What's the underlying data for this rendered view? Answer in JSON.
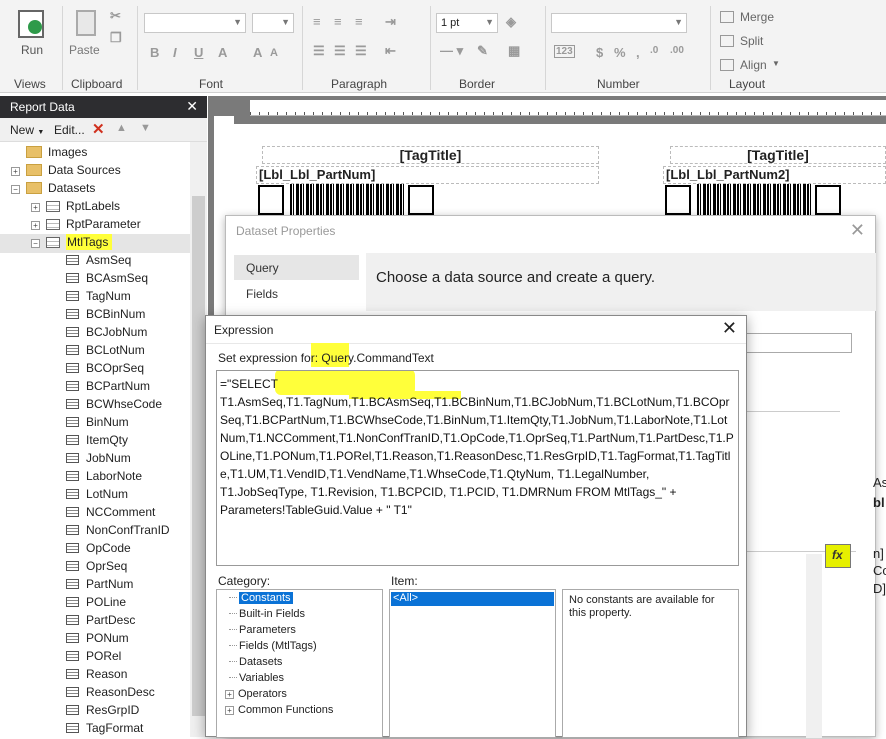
{
  "ribbon": {
    "run_label": "Run",
    "paste_label": "Paste",
    "font_size_value": "1 pt",
    "merge_label": "Merge",
    "split_label": "Split",
    "align_label": "Align",
    "groups": {
      "views": "Views",
      "clipboard": "Clipboard",
      "font": "Font",
      "paragraph": "Paragraph",
      "border": "Border",
      "number": "Number",
      "layout": "Layout"
    },
    "number_symbols": {
      "currency": "$",
      "percent": "%",
      "comma": ","
    }
  },
  "report_data": {
    "title": "Report Data",
    "toolbar": {
      "new_label": "New",
      "edit_label": "Edit..."
    },
    "tree": {
      "images": "Images",
      "data_sources": "Data Sources",
      "datasets": "Datasets",
      "rptlabels": "RptLabels",
      "rptparameter": "RptParameter",
      "mtltags": "MtlTags",
      "fields": [
        "AsmSeq",
        "BCAsmSeq",
        "TagNum",
        "BCBinNum",
        "BCJobNum",
        "BCLotNum",
        "BCOprSeq",
        "BCPartNum",
        "BCWhseCode",
        "BinNum",
        "ItemQty",
        "JobNum",
        "LaborNote",
        "LotNum",
        "NCComment",
        "NonConfTranID",
        "OpCode",
        "OprSeq",
        "PartNum",
        "POLine",
        "PartDesc",
        "PONum",
        "PORel",
        "Reason",
        "ReasonDesc",
        "ResGrpID",
        "TagFormat"
      ]
    }
  },
  "design": {
    "tag_title_1": "[TagTitle]",
    "tag_title_2": "[TagTitle]",
    "lbl_1": "[Lbl_Lbl_PartNum]",
    "lbl_2": "[Lbl_Lbl_PartNum2]",
    "partial_right": [
      "As",
      "bl",
      "n]",
      "Co",
      "D]"
    ]
  },
  "dataset_dialog": {
    "title": "Dataset Properties",
    "nav": [
      "Query",
      "Fields"
    ],
    "heading": "Choose a data source and create a query."
  },
  "expression_dialog": {
    "title": "Expression",
    "set_for_label": "Set expression for: Query.CommandText",
    "expression_text": "=\"SELECT T1.AsmSeq,T1.TagNum,T1.BCAsmSeq,T1.BCBinNum,T1.BCJobNum,T1.BCLotNum,T1.BCOprSeq,T1.BCPartNum,T1.BCWhseCode,T1.BinNum,T1.ItemQty,T1.JobNum,T1.LaborNote,T1.LotNum,T1.NCComment,T1.NonConfTranID,T1.OpCode,T1.OprSeq,T1.PartNum,T1.PartDesc,T1.POLine,T1.PONum,T1.PORel,T1.Reason,T1.ReasonDesc,T1.ResGrpID,T1.TagFormat,T1.TagTitle,T1.UM,T1.VendID,T1.VendName,T1.WhseCode,T1.QtyNum, T1.LegalNumber, T1.JobSeqType, T1.Revision, T1.BCPCID, T1.PCID, T1.DMRNum          FROM MtlTags_\" + Parameters!TableGuid.Value + \" T1\"",
    "category_label": "Category:",
    "item_label": "Item:",
    "categories": [
      "Constants",
      "Built-in Fields",
      "Parameters",
      "Fields (MtlTags)",
      "Datasets",
      "Variables",
      "Operators",
      "Common Functions"
    ],
    "items": [
      "<All>"
    ],
    "description": "No constants are available for this property."
  },
  "fx_button": {
    "label": "fx"
  },
  "colors": {
    "highlight": "#ffff3a",
    "selection": "#0a72d6",
    "panel_title": "#2d2d30"
  }
}
